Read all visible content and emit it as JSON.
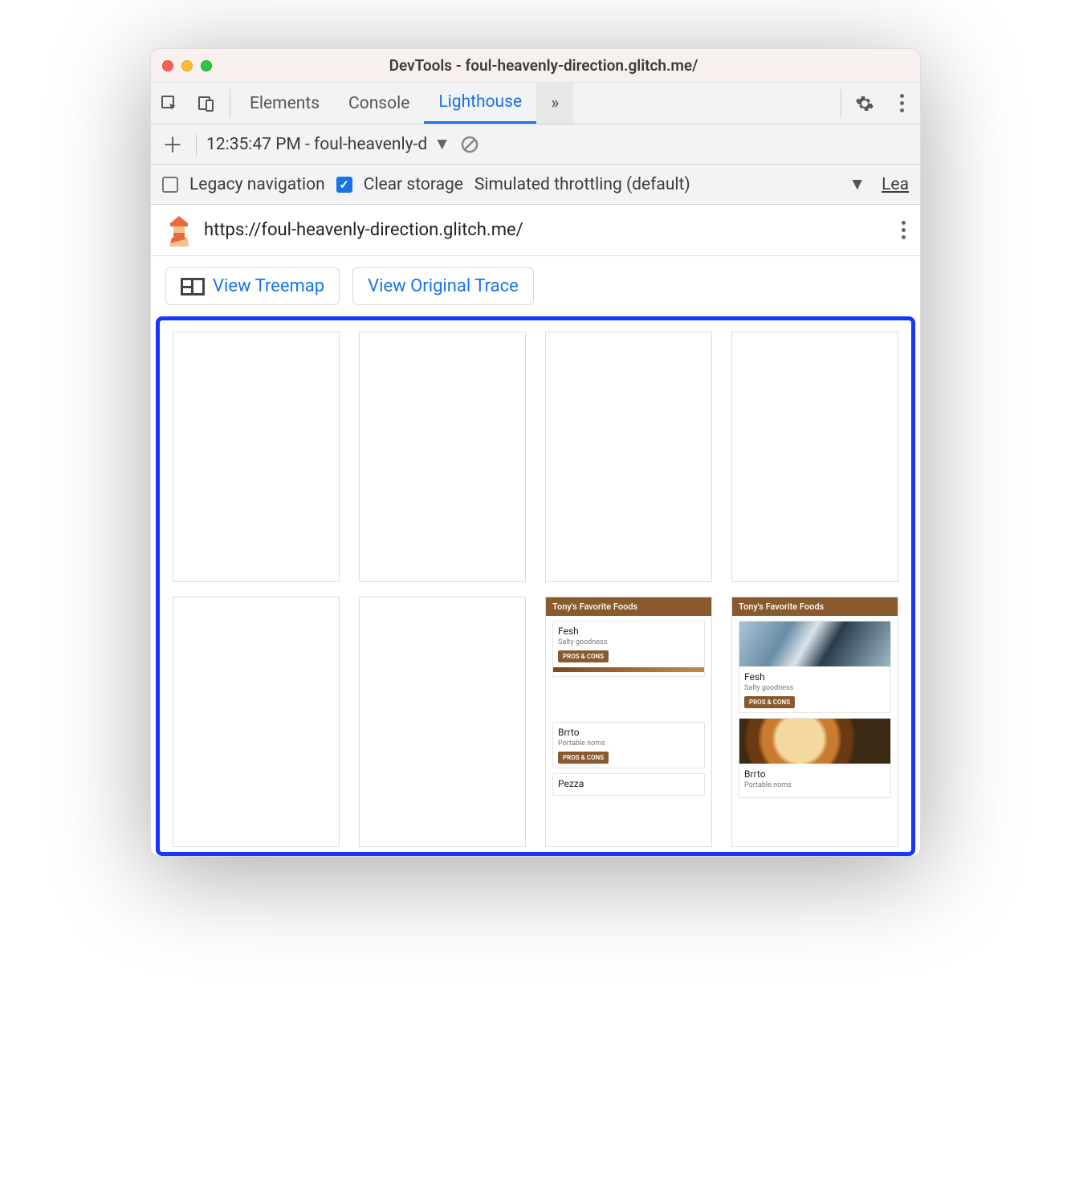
{
  "window": {
    "title": "DevTools - foul-heavenly-direction.glitch.me/"
  },
  "tabs": {
    "elements": "Elements",
    "console": "Console",
    "lighthouse": "Lighthouse"
  },
  "subbar": {
    "report_label": "12:35:47 PM - foul-heavenly-d"
  },
  "options": {
    "legacy_label": "Legacy navigation",
    "clear_label": "Clear storage",
    "throttling_label": "Simulated throttling (default)",
    "learn_more": "Lea"
  },
  "url": {
    "text": "https://foul-heavenly-direction.glitch.me/"
  },
  "buttons": {
    "view_treemap": "View Treemap",
    "view_trace": "View Original Trace"
  },
  "mini": {
    "header": "Tony's Favorite Foods",
    "item1_title": "Fesh",
    "item1_sub": "Salty goodness",
    "item2_title": "Brrto",
    "item2_sub": "Portable noms",
    "item3_title": "Pezza",
    "pill": "PROS & CONS"
  }
}
